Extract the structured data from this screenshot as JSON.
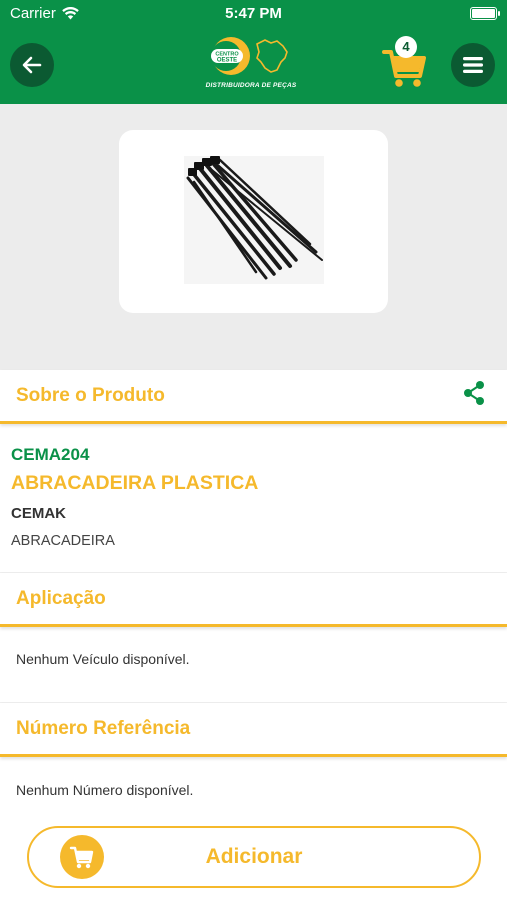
{
  "status_bar": {
    "carrier": "Carrier",
    "time": "5:47 PM",
    "wifi_icon": "wifi-icon",
    "battery_icon": "battery-icon"
  },
  "header": {
    "back_icon": "arrow-left-icon",
    "logo_text": "DISTRIBUIDORA DE PEÇAS",
    "logo_word_1": "CENTRO",
    "logo_word_2": "OESTE",
    "cart_icon": "cart-icon",
    "cart_count": "4",
    "menu_icon": "menu-icon",
    "background_color": "#0a9148",
    "accent_color": "#f5b92c"
  },
  "product": {
    "image_description": "black plastic cable ties",
    "about_title": "Sobre o Produto",
    "share_icon": "share-icon",
    "sku": "CEMA204",
    "name": "ABRACADEIRA PLASTICA",
    "brand": "CEMAK",
    "category": "ABRACADEIRA"
  },
  "application": {
    "title": "Aplicação",
    "text": "Nenhum Veículo disponível."
  },
  "reference": {
    "title": "Número Referência",
    "text": "Nenhum Número disponível."
  },
  "add_button": {
    "label": "Adicionar",
    "icon": "cart-icon"
  }
}
